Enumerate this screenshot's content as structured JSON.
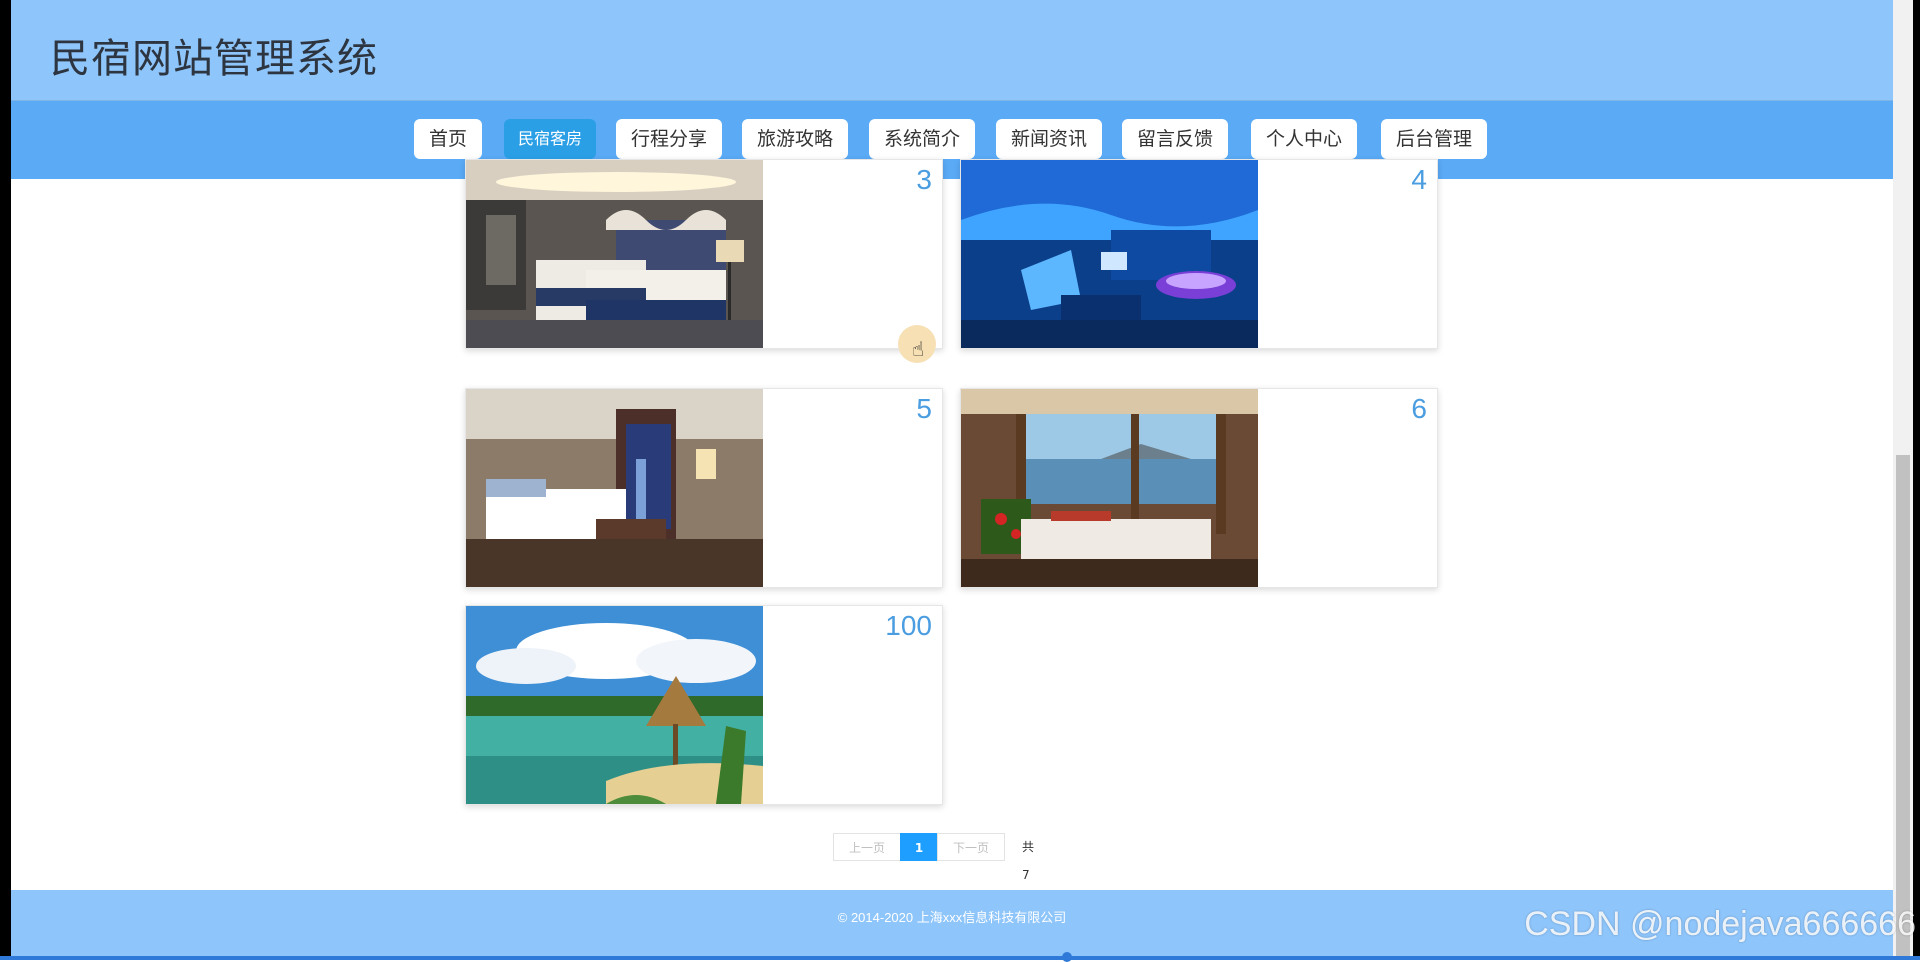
{
  "site": {
    "title": "民宿网站管理系统"
  },
  "nav": {
    "items": [
      {
        "label": "首页"
      },
      {
        "label": "民宿客房",
        "active": true
      },
      {
        "label": "行程分享"
      },
      {
        "label": "旅游攻略"
      },
      {
        "label": "系统简介"
      },
      {
        "label": "新闻资讯"
      },
      {
        "label": "留言反馈"
      },
      {
        "label": "个人中心"
      },
      {
        "label": "后台管理"
      }
    ]
  },
  "rooms": [
    {
      "number": "3",
      "image": "hotel-room-twin-beds"
    },
    {
      "number": "4",
      "image": "underwater-theme-room"
    },
    {
      "number": "5",
      "image": "city-view-bedroom"
    },
    {
      "number": "6",
      "image": "sea-view-bedroom"
    },
    {
      "number": "100",
      "image": "tropical-beach-hut"
    }
  ],
  "pagination": {
    "prev": "上一页",
    "current": "1",
    "next": "下一页",
    "total": "共 7 条"
  },
  "footer": {
    "copyright": "© 2014-2020 上海xxx信息科技有限公司"
  },
  "watermark": "CSDN @nodejava666666",
  "colors": {
    "header": "#8ec5fb",
    "nav": "#5aaaf6",
    "accent": "#2a9fe6",
    "page_current": "#1e9fff"
  }
}
